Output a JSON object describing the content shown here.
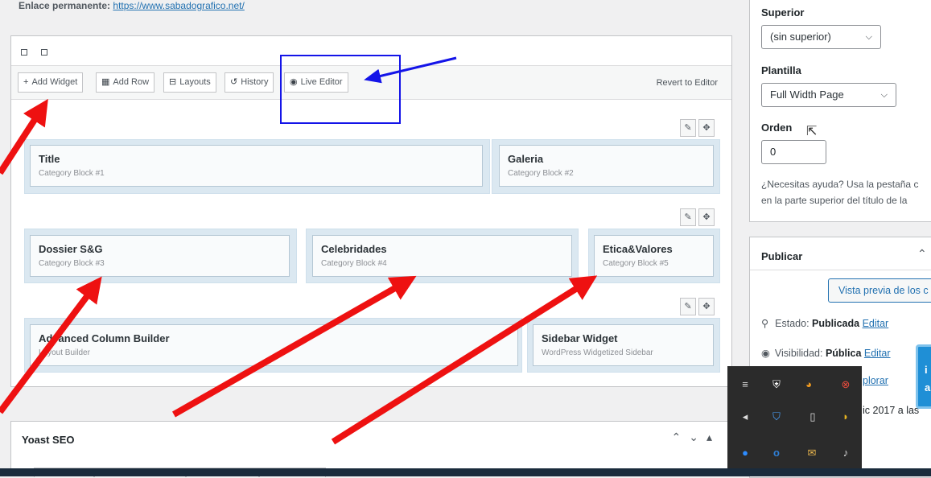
{
  "permalink": {
    "label": "Enlace permanente:",
    "url": "https://www.sabadografico.net/"
  },
  "toolbar": {
    "add_widget": "Add Widget",
    "add_row": "Add Row",
    "layouts": "Layouts",
    "history": "History",
    "live_editor": "Live Editor",
    "revert": "Revert to Editor"
  },
  "rows": [
    {
      "widgets": [
        {
          "title": "Title",
          "subtitle": "Category Block #1"
        },
        {
          "title": "Galeria",
          "subtitle": "Category Block #2"
        }
      ]
    },
    {
      "widgets": [
        {
          "title": "Dossier S&G",
          "subtitle": "Category Block #3"
        },
        {
          "title": "Celebridades",
          "subtitle": "Category Block #4"
        },
        {
          "title": "Etica&Valores",
          "subtitle": "Category Block #5"
        }
      ]
    },
    {
      "widgets": [
        {
          "title": "Advanced Column Builder",
          "subtitle": "Layout Builder"
        },
        {
          "title": "Sidebar Widget",
          "subtitle": "WordPress Widgetized Sidebar"
        }
      ]
    }
  ],
  "yoast": {
    "title": "Yoast SEO"
  },
  "attributes": {
    "parent_label": "Superior",
    "parent_value": "(sin superior)",
    "template_label": "Plantilla",
    "template_value": "Full Width Page",
    "order_label": "Orden",
    "order_value": "0",
    "help_line1": "¿Necesitas ayuda? Usa la pestaña c",
    "help_line2": "en la parte superior del título de la"
  },
  "publish": {
    "title": "Publicar",
    "preview_button": "Vista previa de los c",
    "status_label": "Estado:",
    "status_value": "Publicada",
    "status_edit": "Editar",
    "visibility_label": "Visibilidad:",
    "visibility_value": "Pública",
    "visibility_edit": "Editar",
    "revisions_partial": "plorar",
    "published_partial": "ic 2017 a las"
  },
  "tooltip": {
    "line1": "i",
    "line2": "a"
  },
  "colors": {
    "annotation_arrow": "#ee1111",
    "annotation_box": "#1414e8",
    "link": "#2271b1"
  }
}
